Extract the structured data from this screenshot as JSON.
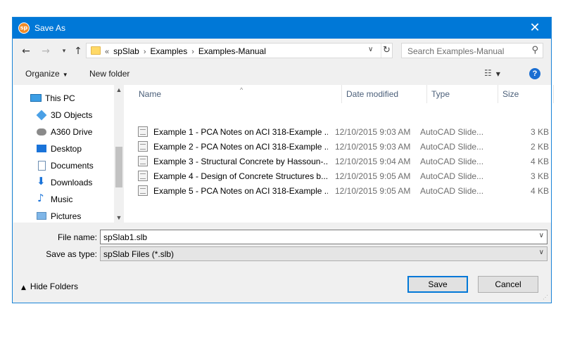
{
  "window": {
    "app_icon_text": "sp",
    "title": "Save As",
    "close_glyph": "✕"
  },
  "nav": {
    "back_glyph": "←",
    "forward_glyph": "→",
    "recent_glyph": "▾",
    "up_glyph": "↑"
  },
  "address": {
    "overflow": "«",
    "crumbs": [
      "spSlab",
      "Examples",
      "Examples-Manual"
    ],
    "separator": "›",
    "dropdown_glyph": "∨",
    "refresh_glyph": "↻"
  },
  "search": {
    "placeholder": "Search Examples-Manual",
    "icon_glyph": "⚲"
  },
  "toolbar": {
    "organize_label": "Organize",
    "new_folder_label": "New folder",
    "view_glyph": "☷",
    "help_glyph": "?"
  },
  "sidebar": {
    "items": [
      {
        "label": "This PC",
        "icon": "pc-icon"
      },
      {
        "label": "3D Objects",
        "icon": "cube-icon"
      },
      {
        "label": "A360 Drive",
        "icon": "cloud-drive-icon"
      },
      {
        "label": "Desktop",
        "icon": "desktop-icon"
      },
      {
        "label": "Documents",
        "icon": "documents-icon"
      },
      {
        "label": "Downloads",
        "icon": "download-icon"
      },
      {
        "label": "Music",
        "icon": "music-icon"
      },
      {
        "label": "Pictures",
        "icon": "pictures-icon"
      }
    ],
    "scroll_position": 0.5
  },
  "columns": {
    "name": "Name",
    "date": "Date modified",
    "type": "Type",
    "size": "Size"
  },
  "files": [
    {
      "name": "Example 1 - PCA Notes on ACI 318-Example ...",
      "date": "12/10/2015 9:03 AM",
      "type": "AutoCAD Slide...",
      "size": "3 KB"
    },
    {
      "name": "Example 2 - PCA Notes on ACI 318-Example ...",
      "date": "12/10/2015 9:03 AM",
      "type": "AutoCAD Slide...",
      "size": "2 KB"
    },
    {
      "name": "Example 3 - Structural Concrete by Hassoun-...",
      "date": "12/10/2015 9:04 AM",
      "type": "AutoCAD Slide...",
      "size": "4 KB"
    },
    {
      "name": "Example 4 - Design of Concrete Structures b...",
      "date": "12/10/2015 9:05 AM",
      "type": "AutoCAD Slide...",
      "size": "3 KB"
    },
    {
      "name": "Example 5 - PCA Notes on ACI 318-Example ...",
      "date": "12/10/2015 9:05 AM",
      "type": "AutoCAD Slide...",
      "size": "4 KB"
    }
  ],
  "form": {
    "file_name_label": "File name:",
    "file_name_value": "spSlab1.slb",
    "save_type_label": "Save as type:",
    "save_type_value": "spSlab Files (*.slb)"
  },
  "footer": {
    "hide_folders_label": "Hide Folders",
    "save_label": "Save",
    "cancel_label": "Cancel"
  },
  "colors": {
    "titlebar": "#0078d7",
    "accent": "#1a6ed2"
  }
}
